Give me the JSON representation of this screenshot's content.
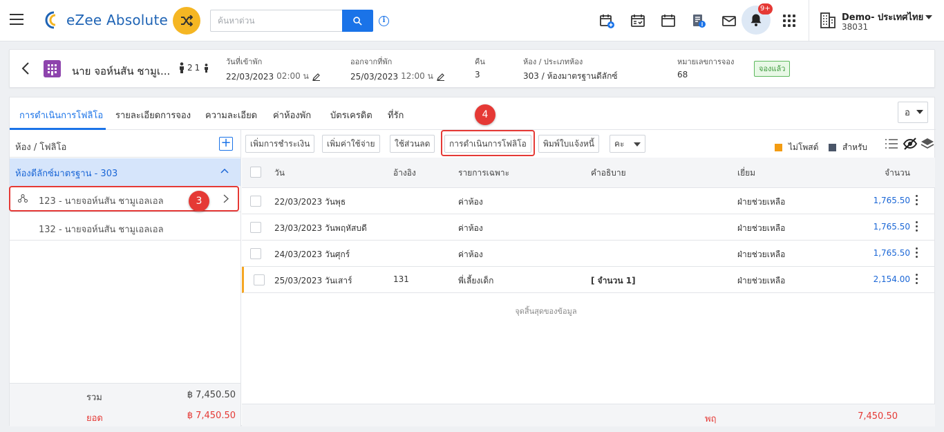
{
  "app": {
    "name": "eZee Absolute"
  },
  "search": {
    "placeholder": "ค้นหาด่วน"
  },
  "notifications": {
    "badge": "9+"
  },
  "property": {
    "name": "Demo- ประเทศไทย",
    "code": "38031"
  },
  "guest": {
    "name": "นาย จอห์นสัน ชามูเ...",
    "adults": "2",
    "children": "1",
    "arrival_label": "วันที่เข้าพัก",
    "arrival_date": "22/03/2023",
    "arrival_time": "02:00 น",
    "departure_label": "ออกจากที่พัก",
    "departure_date": "25/03/2023",
    "departure_time": "12:00 น",
    "nights_label": "คืน",
    "nights": "3",
    "room_label": "ห้อง / ประเภทห้อง",
    "room_value": "303 / ห้องมาตรฐานดีลักซ์",
    "reservation_label": "หมายเลขการจอง",
    "reservation_no": "68",
    "status": "จองแล้ว"
  },
  "tabs": [
    {
      "label": "การดำเนินการโฟลิโอ",
      "active": true
    },
    {
      "label": "รายละเอียดการจอง"
    },
    {
      "label": "ความละเอียด"
    },
    {
      "label": "ค่าห้องพัก"
    },
    {
      "label": "บัตรเครดิต"
    },
    {
      "label": "ที่รัก"
    }
  ],
  "language": "อ",
  "left_panel": {
    "title": "ห้อง / โฟลิโอ",
    "room_group": "ห้องดีลักซ์มาตรฐาน - 303",
    "folios": [
      {
        "label": "123 - นายจอห์นสัน ชามูเอลเอล"
      },
      {
        "label": "132 - นายจอห์นสัน ชามูเอลเอล"
      }
    ],
    "total_label": "รวม",
    "total_value": "฿ 7,450.50",
    "balance_label": "ยอด",
    "balance_value": "฿ 7,450.50"
  },
  "actions": {
    "add_payment": "เพิ่มการชำระเงิน",
    "add_charge": "เพิ่มค่าใช้จ่าย",
    "apply_discount": "ใช้ส่วนลด",
    "folio_operations": "การดำเนินการโฟลิโอ",
    "print_invoice": "พิมพ์ใบแจ้งหนี้",
    "more": "คะ"
  },
  "legend": {
    "unposted": "ไม่โพสต์",
    "for": "สำหรับ",
    "unposted_color": "#f39c12",
    "for_color": "#4a5568"
  },
  "table": {
    "headers": {
      "date": "วัน",
      "ref": "อ้างอิง",
      "particulars": "รายการเฉพาะ",
      "description": "คำอธิบาย",
      "user": "เยี่ยม",
      "amount": "จำนวน"
    },
    "rows": [
      {
        "date": "22/03/2023 วันพุธ",
        "ref": "",
        "particulars": "ค่าห้อง",
        "description": "",
        "user": "ฝ่ายช่วยเหลือ",
        "amount": "1,765.50"
      },
      {
        "date": "23/03/2023 วันพฤหัสบดี",
        "ref": "",
        "particulars": "ค่าห้อง",
        "description": "",
        "user": "ฝ่ายช่วยเหลือ",
        "amount": "1,765.50"
      },
      {
        "date": "24/03/2023 วันศุกร์",
        "ref": "",
        "particulars": "ค่าห้อง",
        "description": "",
        "user": "ฝ่ายช่วยเหลือ",
        "amount": "1,765.50"
      },
      {
        "date": "25/03/2023 วันเสาร์",
        "ref": "131",
        "particulars": "พี่เลี้ยงเด็ก",
        "description": "[ จำนวน 1]",
        "user": "ฝ่ายช่วยเหลือ",
        "amount": "2,154.00"
      }
    ],
    "end_of_data": "จุดสิ้นสุดของข้อมูล",
    "footer_label": "พฤ",
    "footer_value": "7,450.50"
  },
  "annotations": {
    "step3": "3",
    "step4": "4"
  }
}
